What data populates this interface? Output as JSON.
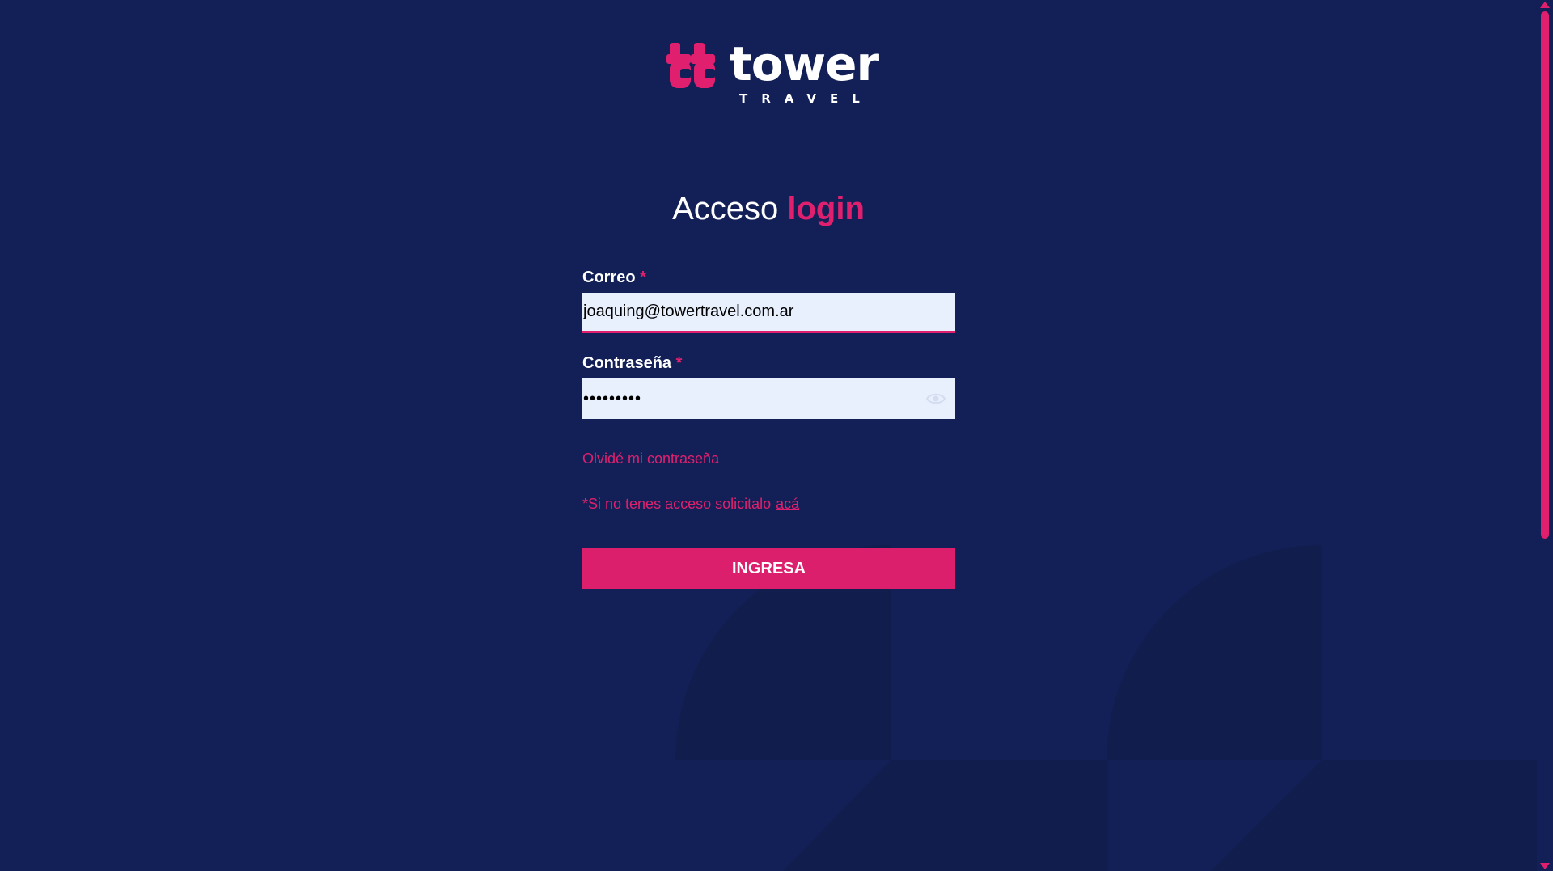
{
  "brand": {
    "name": "tower",
    "subtitle": "TRAVEL",
    "accent_color": "#e0206e",
    "background_color": "#132057"
  },
  "heading": {
    "prefix": "Acceso",
    "highlight": "login"
  },
  "form": {
    "email": {
      "label": "Correo",
      "required_mark": "*",
      "value": "joaquing@towertravel.com.ar"
    },
    "password": {
      "label": "Contraseña",
      "required_mark": "*",
      "value": "•••••••••",
      "toggle_icon": "eye-icon"
    },
    "forgot_link": "Olvidé mi contraseña",
    "request_text": "*Si no tenes acceso solicitalo",
    "request_link": "acá",
    "submit_label": "INGRESA"
  }
}
